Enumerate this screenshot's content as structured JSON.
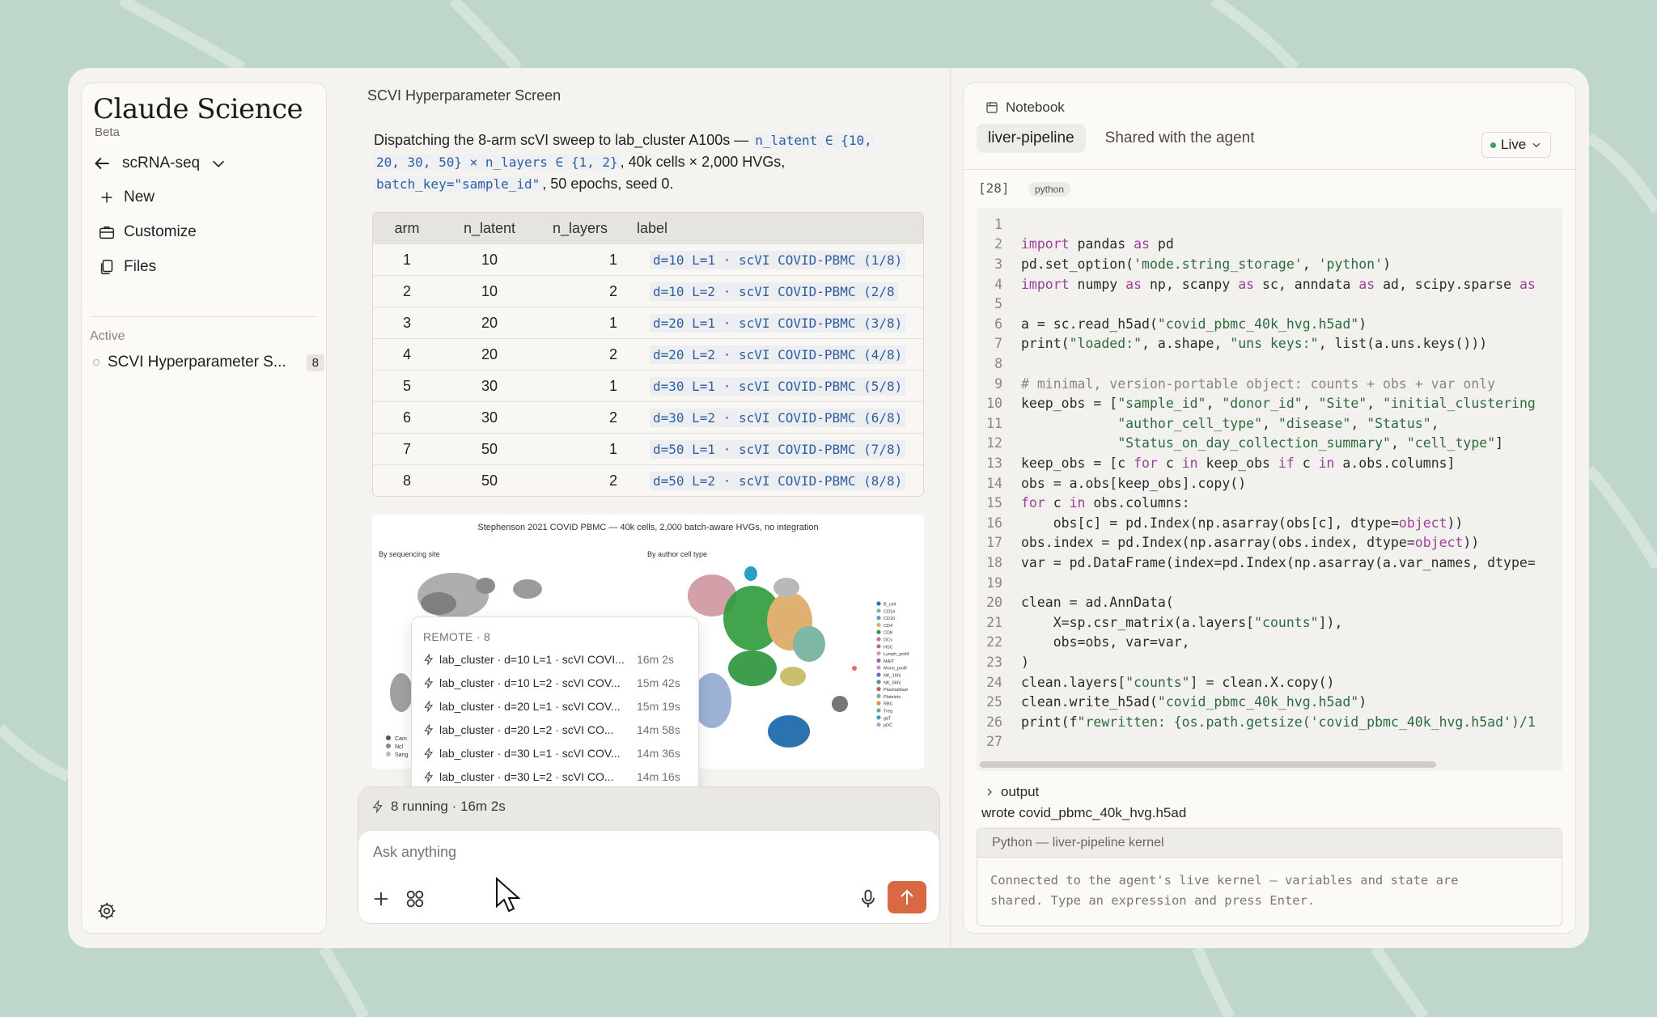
{
  "sidebar": {
    "brand": "Claude Science",
    "beta": "Beta",
    "project": "scRNA-seq",
    "nav": {
      "new": "New",
      "customize": "Customize",
      "files": "Files"
    },
    "active_header": "Active",
    "active_item": {
      "label": "SCVI Hyperparameter S...",
      "count": "8"
    }
  },
  "chat": {
    "title": "SCVI Hyperparameter Screen",
    "message": {
      "t1": "Dispatching the 8-arm scVI sweep to lab_cluster A100s — ",
      "c1": "n_latent ∈ {10,",
      "c2": "20, 30, 50} × n_layers ∈ {1, 2}",
      "t2": ", 40k cells × 2,000 HVGs,",
      "c3": "batch_key=\"sample_id\"",
      "t3": ", 50 epochs, seed 0."
    },
    "table": {
      "headers": [
        "arm",
        "n_latent",
        "n_layers",
        "label"
      ],
      "rows": [
        [
          "1",
          "10",
          "1",
          "d=10 L=1 · scVI COVID-PBMC (1/8)"
        ],
        [
          "2",
          "10",
          "2",
          "d=10 L=2 · scVI COVID-PBMC (2/8"
        ],
        [
          "3",
          "20",
          "1",
          "d=20 L=1 · scVI COVID-PBMC (3/8)"
        ],
        [
          "4",
          "20",
          "2",
          "d=20 L=2 · scVI COVID-PBMC (4/8)"
        ],
        [
          "5",
          "30",
          "1",
          "d=30 L=1 · scVI COVID-PBMC (5/8)"
        ],
        [
          "6",
          "30",
          "2",
          "d=30 L=2 · scVI COVID-PBMC (6/8)"
        ],
        [
          "7",
          "50",
          "1",
          "d=50 L=1 · scVI COVID-PBMC (7/8)"
        ],
        [
          "8",
          "50",
          "2",
          "d=50 L=2 · scVI COVID-PBMC (8/8)"
        ]
      ]
    },
    "figure": {
      "title": "Stephenson 2021 COVID PBMC — 40k cells, 2,000 batch-aware HVGs, no integration",
      "panel1": "By sequencing site",
      "panel2": "By author cell type",
      "legend_site": [
        "Cam",
        "Ncl",
        "Sang"
      ],
      "legend_type": [
        "B_cell",
        "CD14",
        "CD16",
        "CD4",
        "CD8",
        "DCs",
        "HSC",
        "Lymph_prolif",
        "MAIT",
        "Mono_prolif",
        "NK_16hi",
        "NK_56hi",
        "Plasmablast",
        "Platelets",
        "RBC",
        "Treg",
        "gdT",
        "pDC"
      ]
    },
    "remote": {
      "header": "REMOTE · 8",
      "jobs": [
        {
          "label": "lab_cluster · d=10 L=1 · scVI COVI...",
          "time": "16m 2s"
        },
        {
          "label": "lab_cluster · d=10 L=2 · scVI COV...",
          "time": "15m 42s"
        },
        {
          "label": "lab_cluster · d=20 L=1 · scVI COV...",
          "time": "15m 19s"
        },
        {
          "label": "lab_cluster · d=20 L=2 · scVI CO...",
          "time": "14m 58s"
        },
        {
          "label": "lab_cluster · d=30 L=1 · scVI COV...",
          "time": "14m 36s"
        },
        {
          "label": "lab_cluster · d=30 L=2 · scVI CO...",
          "time": "14m 16s"
        }
      ]
    },
    "composer": {
      "running": "8 running · 16m 2s",
      "placeholder": "Ask anything"
    }
  },
  "notebook": {
    "title": "Notebook",
    "tabs": [
      "liver-pipeline",
      "Shared with the agent"
    ],
    "live": "Live",
    "exec_count": "[28]",
    "language": "python",
    "output_toggle": "output",
    "output_text": "wrote covid_pbmc_40k_hvg.h5ad",
    "kernel_title": "Python — liver-pipeline kernel",
    "kernel_msg": "Connected to the agent's live kernel — variables and state are shared. Type an expression and press Enter."
  },
  "colors": {
    "accent": "#d96942",
    "live": "#3aa552",
    "code_blue": "#2f5f9e"
  }
}
